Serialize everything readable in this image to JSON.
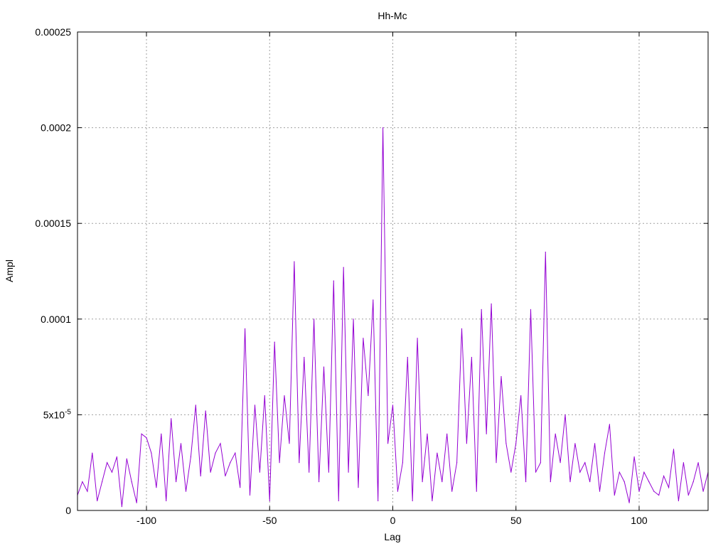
{
  "chart_data": {
    "type": "line",
    "title": "Hh-Mc",
    "xlabel": "Lag",
    "ylabel": "Ampl",
    "xlim": [
      -128,
      128
    ],
    "ylim": [
      0,
      0.00025
    ],
    "grid": true,
    "x_ticks": [
      {
        "value": -100,
        "label": "-100"
      },
      {
        "value": -50,
        "label": "-50"
      },
      {
        "value": 0,
        "label": "0"
      },
      {
        "value": 50,
        "label": "50"
      },
      {
        "value": 100,
        "label": "100"
      }
    ],
    "y_ticks": [
      {
        "value": 0,
        "label": "0"
      },
      {
        "value": 5e-05,
        "label": "5x10",
        "sup": "-5"
      },
      {
        "value": 0.0001,
        "label": "0.0001"
      },
      {
        "value": 0.00015,
        "label": "0.00015"
      },
      {
        "value": 0.0002,
        "label": "0.0002"
      },
      {
        "value": 0.00025,
        "label": "0.00025"
      }
    ],
    "series": [
      {
        "color": "#9400d3",
        "x": [
          -128,
          -126,
          -124,
          -122,
          -120,
          -118,
          -116,
          -114,
          -112,
          -110,
          -108,
          -106,
          -104,
          -102,
          -100,
          -98,
          -96,
          -94,
          -92,
          -90,
          -88,
          -86,
          -84,
          -82,
          -80,
          -78,
          -76,
          -74,
          -72,
          -70,
          -68,
          -66,
          -64,
          -62,
          -60,
          -58,
          -56,
          -54,
          -52,
          -50,
          -48,
          -46,
          -44,
          -42,
          -40,
          -38,
          -36,
          -34,
          -32,
          -30,
          -28,
          -26,
          -24,
          -22,
          -20,
          -18,
          -16,
          -14,
          -12,
          -10,
          -8,
          -6,
          -4,
          -2,
          0,
          2,
          4,
          6,
          8,
          10,
          12,
          14,
          16,
          18,
          20,
          22,
          24,
          26,
          28,
          30,
          32,
          34,
          36,
          38,
          40,
          42,
          44,
          46,
          48,
          50,
          52,
          54,
          56,
          58,
          60,
          62,
          64,
          66,
          68,
          70,
          72,
          74,
          76,
          78,
          80,
          82,
          84,
          86,
          88,
          90,
          92,
          94,
          96,
          98,
          100,
          102,
          104,
          106,
          108,
          110,
          112,
          114,
          116,
          118,
          120,
          122,
          124,
          126,
          128
        ],
        "y": [
          8e-06,
          1.5e-05,
          1e-05,
          3e-05,
          5e-06,
          1.5e-05,
          2.5e-05,
          2e-05,
          2.8e-05,
          2e-06,
          2.7e-05,
          1.5e-05,
          4e-06,
          4e-05,
          3.8e-05,
          3e-05,
          1.2e-05,
          4e-05,
          5e-06,
          4.8e-05,
          1.5e-05,
          3.5e-05,
          1e-05,
          2.8e-05,
          5.5e-05,
          1.8e-05,
          5.2e-05,
          2e-05,
          3e-05,
          3.5e-05,
          1.8e-05,
          2.5e-05,
          3e-05,
          1.2e-05,
          9.5e-05,
          8e-06,
          5.5e-05,
          2e-05,
          6e-05,
          5e-06,
          8.8e-05,
          2.5e-05,
          6e-05,
          3.5e-05,
          0.00013,
          2.5e-05,
          8e-05,
          2e-05,
          0.0001,
          1.5e-05,
          7.5e-05,
          2e-05,
          0.00012,
          5e-06,
          0.000127,
          2e-05,
          0.0001,
          1.2e-05,
          9e-05,
          6e-05,
          0.00011,
          5e-06,
          0.0002,
          3.5e-05,
          5.5e-05,
          1e-05,
          2.5e-05,
          8e-05,
          5e-06,
          9e-05,
          1.5e-05,
          4e-05,
          5e-06,
          3e-05,
          1.5e-05,
          4e-05,
          1e-05,
          2.5e-05,
          9.5e-05,
          3.5e-05,
          8e-05,
          1e-05,
          0.000105,
          4e-05,
          0.000108,
          2.5e-05,
          7e-05,
          3.5e-05,
          2e-05,
          3.5e-05,
          6e-05,
          1.5e-05,
          0.000105,
          2e-05,
          2.5e-05,
          0.000135,
          1.5e-05,
          4e-05,
          2.5e-05,
          5e-05,
          1.5e-05,
          3.5e-05,
          2e-05,
          2.5e-05,
          1.5e-05,
          3.5e-05,
          1e-05,
          3e-05,
          4.5e-05,
          8e-06,
          2e-05,
          1.5e-05,
          4e-06,
          2.8e-05,
          1e-05,
          2e-05,
          1.5e-05,
          1e-05,
          8e-06,
          1.8e-05,
          1.2e-05,
          3.2e-05,
          5e-06,
          2.5e-05,
          8e-06,
          1.5e-05,
          2.5e-05,
          1e-05,
          2e-05
        ]
      }
    ]
  }
}
